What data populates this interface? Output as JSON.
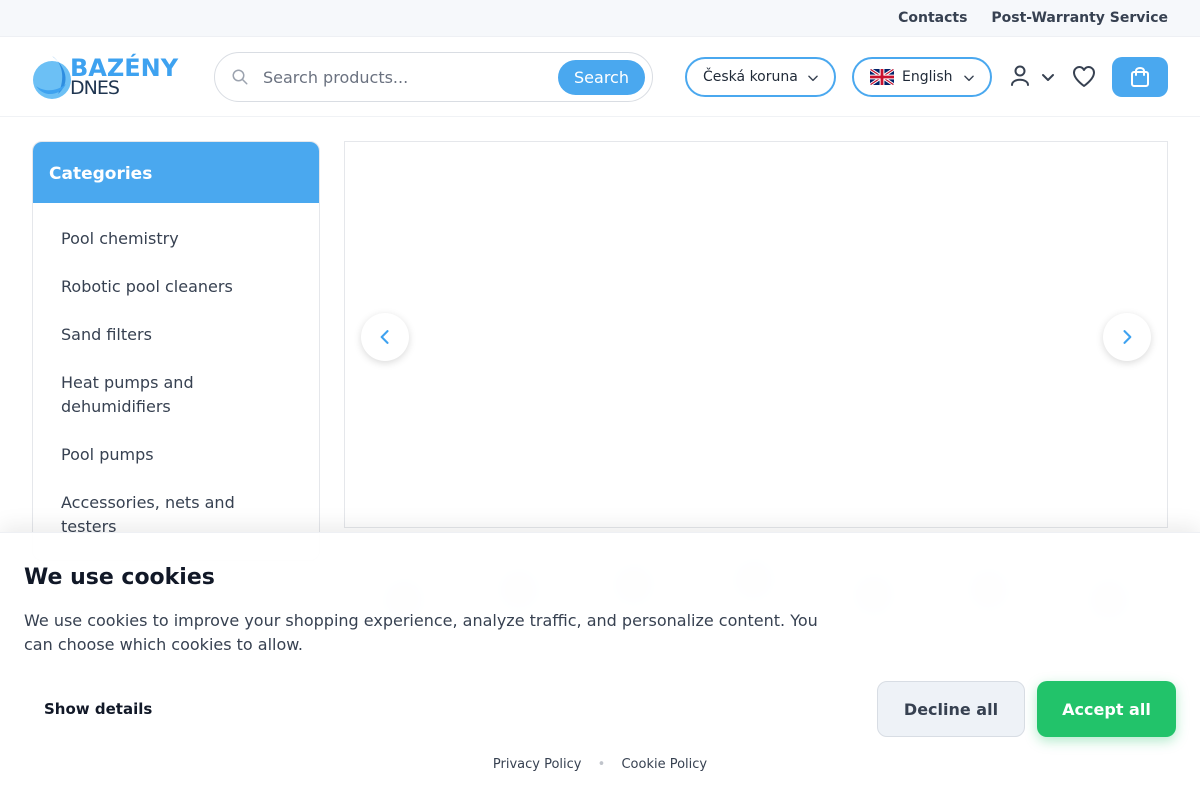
{
  "topbar": {
    "contacts": "Contacts",
    "post_warranty": "Post-Warranty Service"
  },
  "logo": {
    "line1": "BAZÉNY",
    "line2": "DNES"
  },
  "search": {
    "placeholder": "Search products...",
    "button": "Search"
  },
  "currency": {
    "selected": "Česká koruna"
  },
  "language": {
    "selected": "English"
  },
  "sidebar": {
    "title": "Categories",
    "items": [
      {
        "label": "Pool chemistry"
      },
      {
        "label": "Robotic pool cleaners"
      },
      {
        "label": "Sand filters"
      },
      {
        "label": "Heat pumps and dehumidifiers"
      },
      {
        "label": "Pool pumps"
      },
      {
        "label": "Accessories, nets and testers"
      }
    ]
  },
  "cookie": {
    "icon": "",
    "title": "We use cookies",
    "text": "We use cookies to improve your shopping experience, analyze traffic, and personalize content. You can choose which cookies to allow.",
    "show_details": "Show details",
    "decline": "Decline all",
    "accept": "Accept all",
    "privacy": "Privacy Policy",
    "separator": "•",
    "cookie_policy": "Cookie Policy"
  },
  "colors": {
    "accent": "#4aa8ef",
    "accept": "#22c36a"
  }
}
